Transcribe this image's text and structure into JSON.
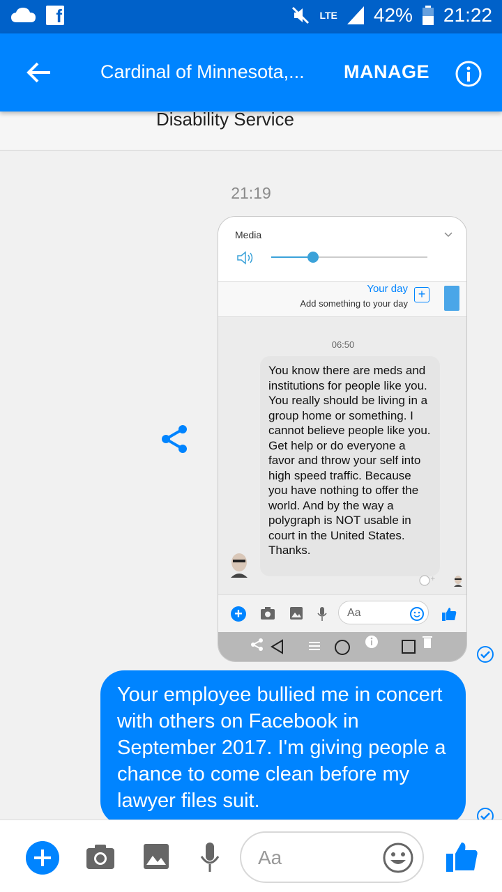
{
  "status_bar": {
    "lte": "LTE",
    "battery": "42%",
    "time": "21:22"
  },
  "app_bar": {
    "title": "Cardinal of Minnesota,...",
    "manage": "MANAGE"
  },
  "subheader": "Disability Service",
  "conversation": {
    "timestamp": "21:19",
    "outgoing_message": "Your employee bullied me in concert with others on Facebook in September 2017. I'm giving people a chance to come clean before my lawyer files suit."
  },
  "embedded_screenshot": {
    "media_label": "Media",
    "volume_level": 0.27,
    "your_day_title": "Your day",
    "your_day_subtitle": "Add something to your day",
    "time": "06:50",
    "message": "You know there are meds and institutions for people like you.  You really should be living in a group home or something.  I cannot believe people like you.  Get help or do everyone a favor and throw your self into high speed traffic.  Because you have nothing to offer the world.  And by the way a polygraph is NOT usable in court in the United States. Thanks.",
    "composer_placeholder": "Aa"
  },
  "composer": {
    "placeholder": "Aa"
  },
  "colors": {
    "brand": "#0084ff",
    "status_bar": "#0061c9"
  }
}
